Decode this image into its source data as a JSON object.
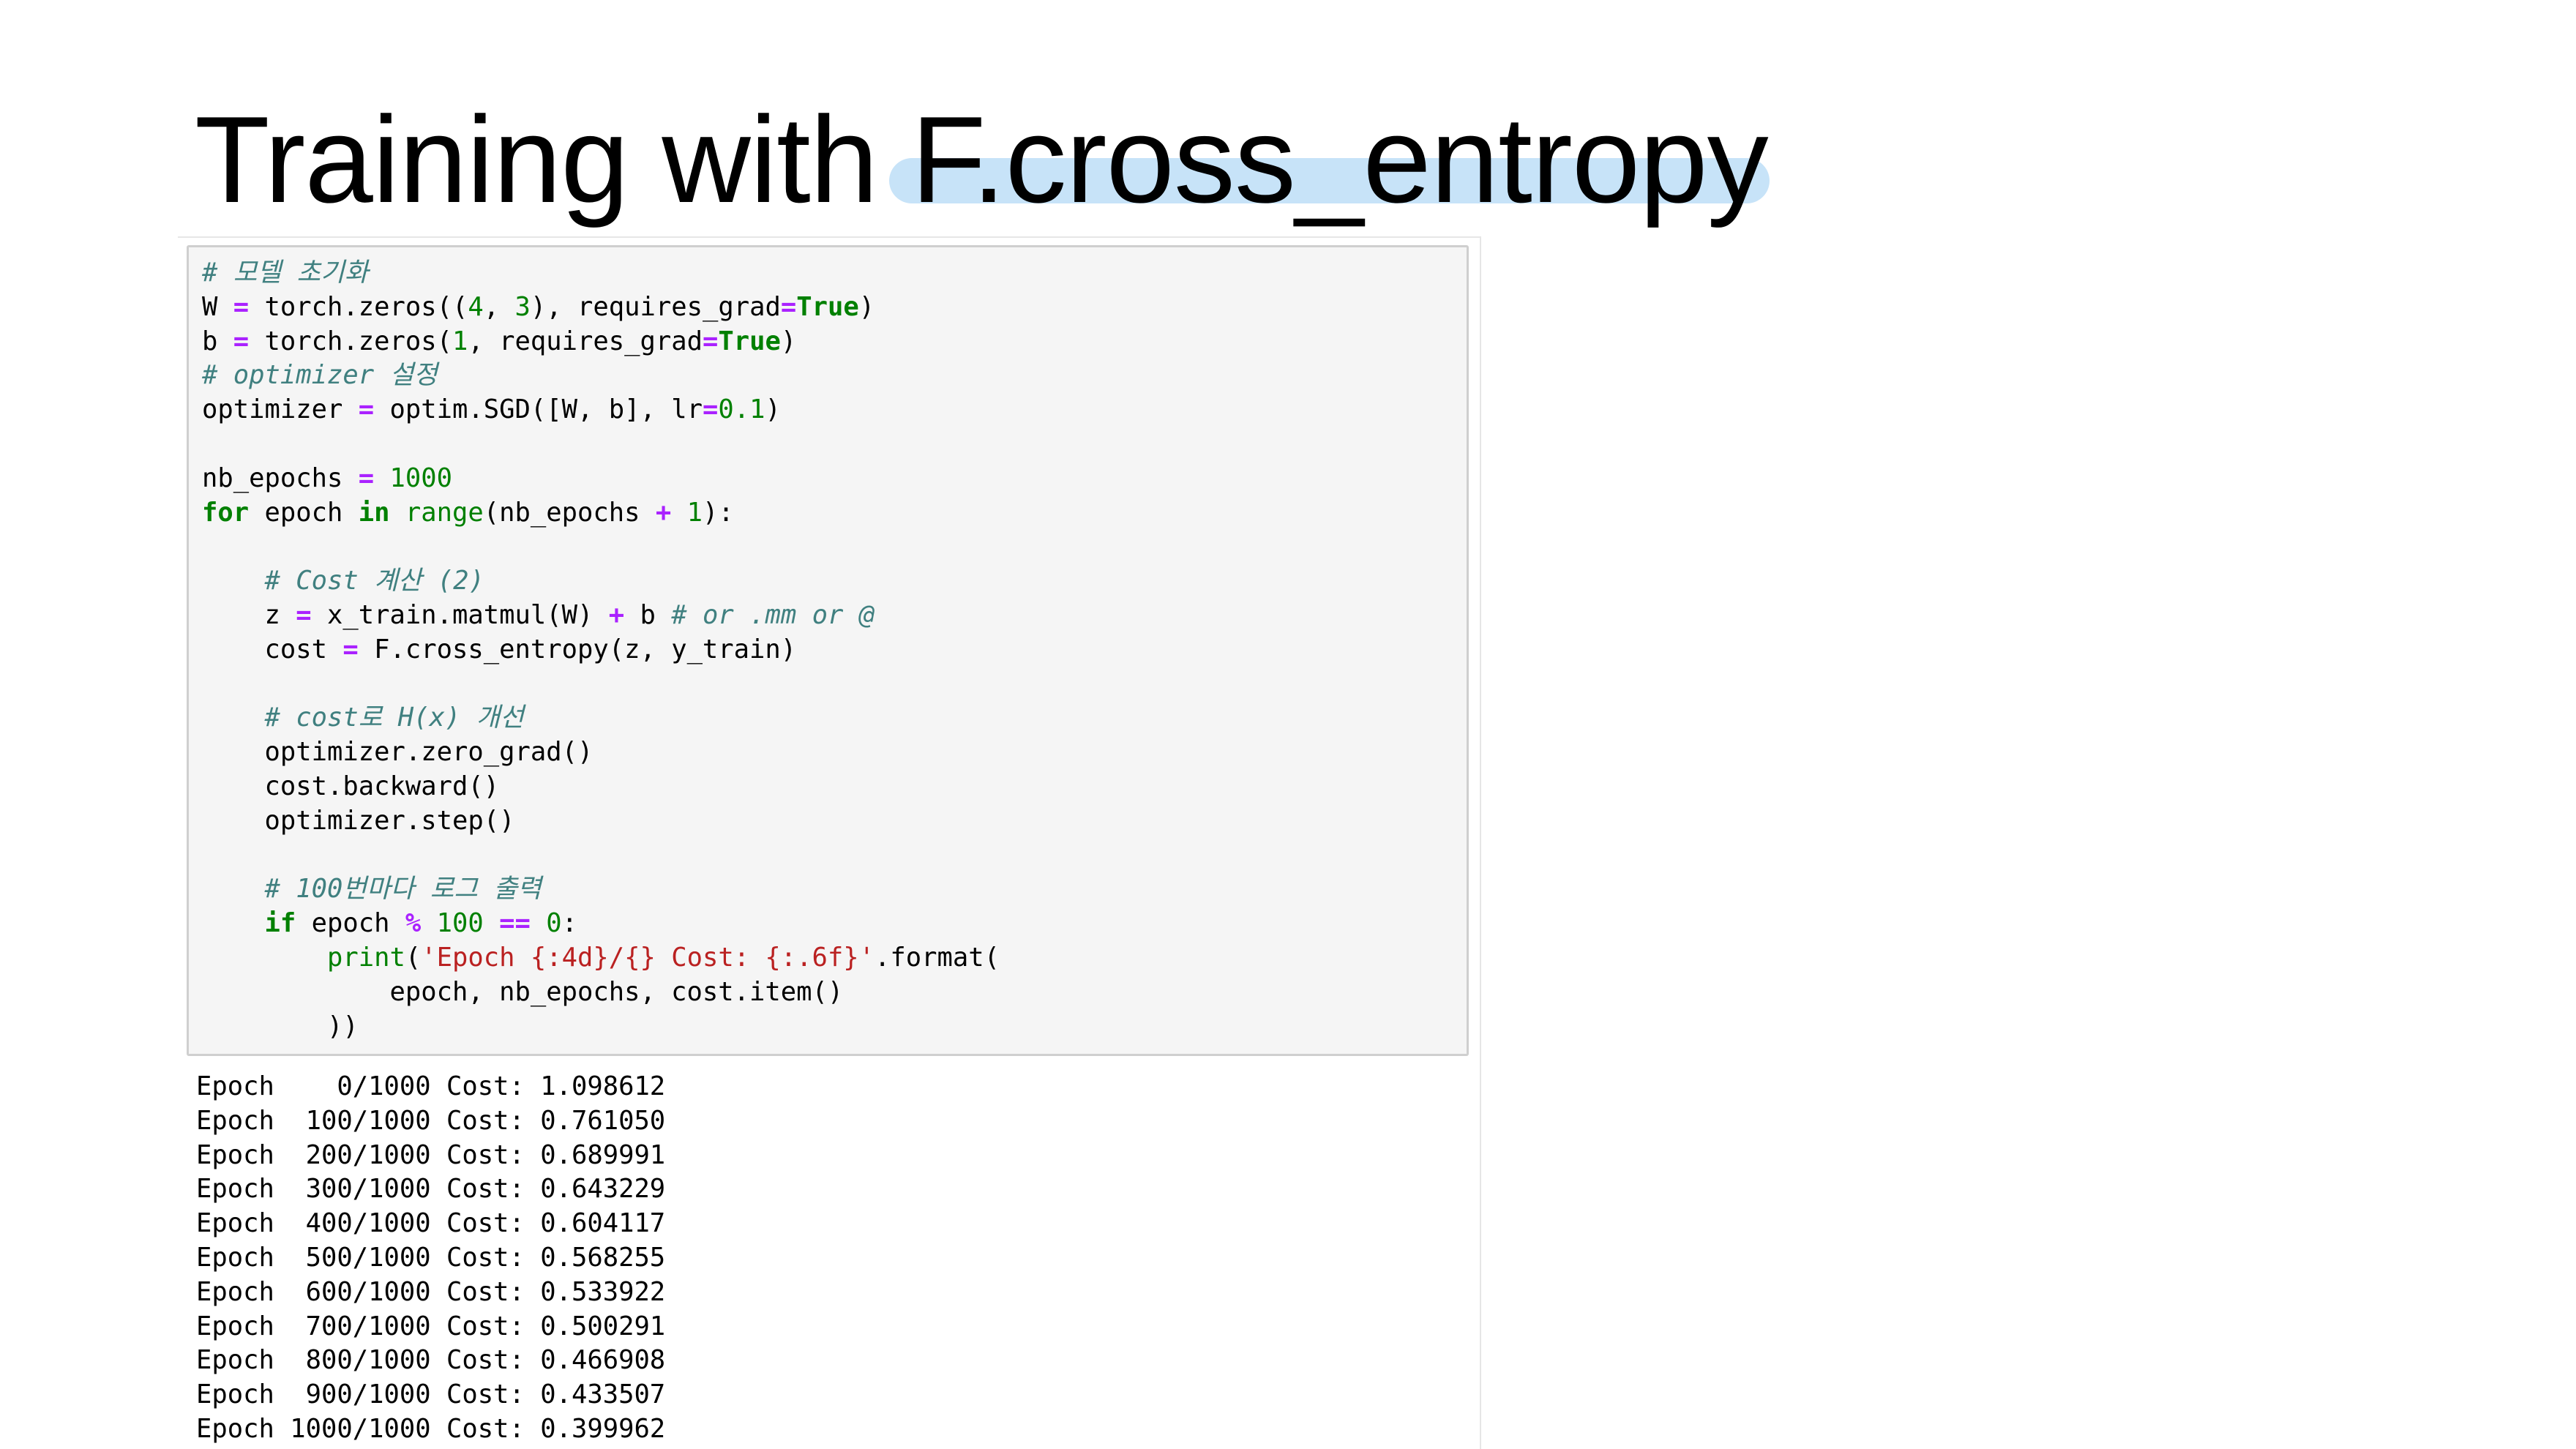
{
  "slide": {
    "title_prefix": "Training with ",
    "title_highlight": "F.cross_entropy"
  },
  "colors": {
    "highlight": "#c7e3f8",
    "comment": "#408080",
    "operator": "#aa22ff",
    "keyword": "#008000",
    "number": "#008000",
    "string": "#ba2121",
    "cell_background": "#f5f5f5",
    "cell_border": "#cfcfcf"
  },
  "code_cell": {
    "lines": [
      [
        {
          "t": "# 모델 초기화",
          "c": "cm"
        }
      ],
      [
        {
          "t": "W ",
          "c": "nm"
        },
        {
          "t": "=",
          "c": "op"
        },
        {
          "t": " torch.zeros((",
          "c": "nm"
        },
        {
          "t": "4",
          "c": "num"
        },
        {
          "t": ", ",
          "c": "nm"
        },
        {
          "t": "3",
          "c": "num"
        },
        {
          "t": "), requires_grad",
          "c": "nm"
        },
        {
          "t": "=",
          "c": "op"
        },
        {
          "t": "True",
          "c": "kw"
        },
        {
          "t": ")",
          "c": "nm"
        }
      ],
      [
        {
          "t": "b ",
          "c": "nm"
        },
        {
          "t": "=",
          "c": "op"
        },
        {
          "t": " torch.zeros(",
          "c": "nm"
        },
        {
          "t": "1",
          "c": "num"
        },
        {
          "t": ", requires_grad",
          "c": "nm"
        },
        {
          "t": "=",
          "c": "op"
        },
        {
          "t": "True",
          "c": "kw"
        },
        {
          "t": ")",
          "c": "nm"
        }
      ],
      [
        {
          "t": "# optimizer 설정",
          "c": "cm"
        }
      ],
      [
        {
          "t": "optimizer ",
          "c": "nm"
        },
        {
          "t": "=",
          "c": "op"
        },
        {
          "t": " optim.SGD([W, b], lr",
          "c": "nm"
        },
        {
          "t": "=",
          "c": "op"
        },
        {
          "t": "0.1",
          "c": "num"
        },
        {
          "t": ")",
          "c": "nm"
        }
      ],
      [],
      [
        {
          "t": "nb_epochs ",
          "c": "nm"
        },
        {
          "t": "=",
          "c": "op"
        },
        {
          "t": " ",
          "c": "nm"
        },
        {
          "t": "1000",
          "c": "num"
        }
      ],
      [
        {
          "t": "for",
          "c": "kw"
        },
        {
          "t": " epoch ",
          "c": "nm"
        },
        {
          "t": "in",
          "c": "kw"
        },
        {
          "t": " ",
          "c": "nm"
        },
        {
          "t": "range",
          "c": "bi"
        },
        {
          "t": "(nb_epochs ",
          "c": "nm"
        },
        {
          "t": "+",
          "c": "op"
        },
        {
          "t": " ",
          "c": "nm"
        },
        {
          "t": "1",
          "c": "num"
        },
        {
          "t": "):",
          "c": "nm"
        }
      ],
      [],
      [
        {
          "t": "    ",
          "c": "nm"
        },
        {
          "t": "# Cost 계산 (2)",
          "c": "cm"
        }
      ],
      [
        {
          "t": "    z ",
          "c": "nm"
        },
        {
          "t": "=",
          "c": "op"
        },
        {
          "t": " x_train.matmul(W) ",
          "c": "nm"
        },
        {
          "t": "+",
          "c": "op"
        },
        {
          "t": " b ",
          "c": "nm"
        },
        {
          "t": "# or .mm or @",
          "c": "cm"
        }
      ],
      [
        {
          "t": "    cost ",
          "c": "nm"
        },
        {
          "t": "=",
          "c": "op"
        },
        {
          "t": " F.cross_entropy(z, y_train)",
          "c": "nm"
        }
      ],
      [],
      [
        {
          "t": "    ",
          "c": "nm"
        },
        {
          "t": "# cost로 H(x) 개선",
          "c": "cm"
        }
      ],
      [
        {
          "t": "    optimizer.zero_grad()",
          "c": "nm"
        }
      ],
      [
        {
          "t": "    cost.backward()",
          "c": "nm"
        }
      ],
      [
        {
          "t": "    optimizer.step()",
          "c": "nm"
        }
      ],
      [],
      [
        {
          "t": "    ",
          "c": "nm"
        },
        {
          "t": "# 100번마다 로그 출력",
          "c": "cm"
        }
      ],
      [
        {
          "t": "    ",
          "c": "nm"
        },
        {
          "t": "if",
          "c": "kw"
        },
        {
          "t": " epoch ",
          "c": "nm"
        },
        {
          "t": "%",
          "c": "op"
        },
        {
          "t": " ",
          "c": "nm"
        },
        {
          "t": "100",
          "c": "num"
        },
        {
          "t": " ",
          "c": "nm"
        },
        {
          "t": "==",
          "c": "op"
        },
        {
          "t": " ",
          "c": "nm"
        },
        {
          "t": "0",
          "c": "num"
        },
        {
          "t": ":",
          "c": "nm"
        }
      ],
      [
        {
          "t": "        ",
          "c": "nm"
        },
        {
          "t": "print",
          "c": "bi"
        },
        {
          "t": "(",
          "c": "nm"
        },
        {
          "t": "'Epoch {:4d}/{} Cost: {:.6f}'",
          "c": "str"
        },
        {
          "t": ".format(",
          "c": "nm"
        }
      ],
      [
        {
          "t": "            epoch, nb_epochs, cost.item()",
          "c": "nm"
        }
      ],
      [
        {
          "t": "        ))",
          "c": "nm"
        }
      ]
    ]
  },
  "output_cell": {
    "lines": [
      "Epoch    0/1000 Cost: 1.098612",
      "Epoch  100/1000 Cost: 0.761050",
      "Epoch  200/1000 Cost: 0.689991",
      "Epoch  300/1000 Cost: 0.643229",
      "Epoch  400/1000 Cost: 0.604117",
      "Epoch  500/1000 Cost: 0.568255",
      "Epoch  600/1000 Cost: 0.533922",
      "Epoch  700/1000 Cost: 0.500291",
      "Epoch  800/1000 Cost: 0.466908",
      "Epoch  900/1000 Cost: 0.433507",
      "Epoch 1000/1000 Cost: 0.399962"
    ]
  }
}
